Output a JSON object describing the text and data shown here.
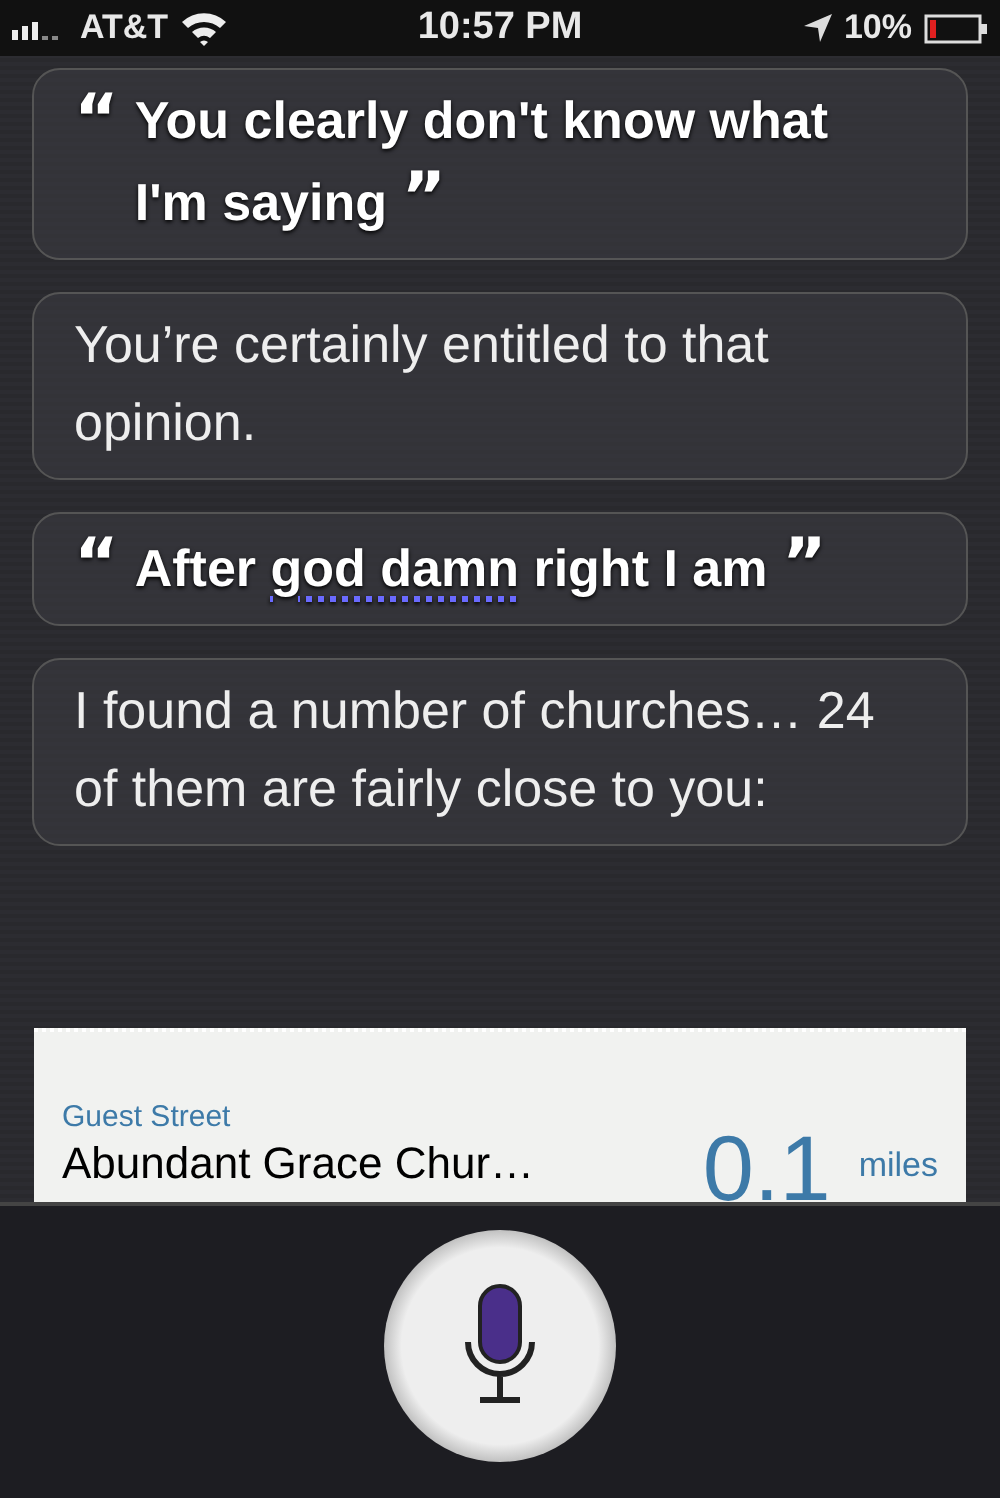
{
  "status_bar": {
    "carrier": "AT&T",
    "time": "10:57 PM",
    "battery": "10%"
  },
  "conversation": [
    {
      "kind": "user",
      "open_quote": "“",
      "parts": [
        {
          "text": "You clearly don't know what I'm saying",
          "flagged": false
        }
      ],
      "close_quote": "”"
    },
    {
      "kind": "siri",
      "text": "You’re certainly entitled to that opinion."
    },
    {
      "kind": "user",
      "open_quote": "“",
      "parts": [
        {
          "text": "After ",
          "flagged": false
        },
        {
          "text": "god damn",
          "flagged": true
        },
        {
          "text": " right I am",
          "flagged": false
        }
      ],
      "close_quote": "”"
    },
    {
      "kind": "siri",
      "text": "I found a number of churches… 24 of them are fairly close to you:"
    }
  ],
  "result_card": {
    "street": "Guest Street",
    "name": "Abundant Grace Chur…",
    "distance": "0.1",
    "unit": "miles"
  }
}
